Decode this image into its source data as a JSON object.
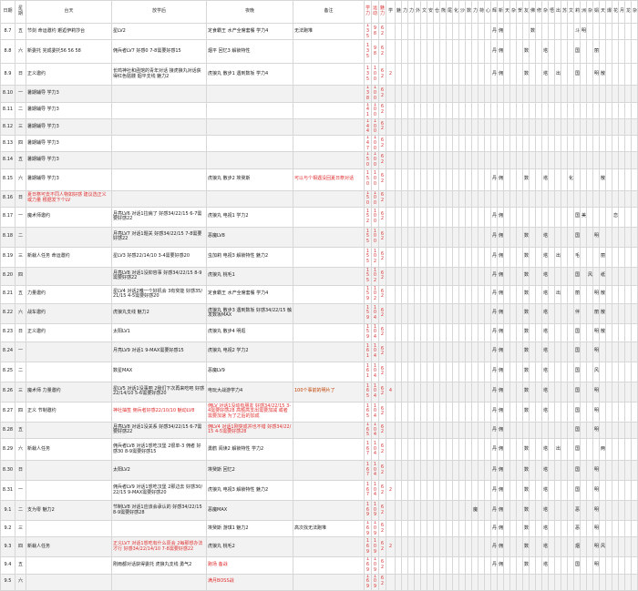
{
  "headers": [
    "日期",
    "星期",
    "台天",
    "放学后",
    "夜晚",
    "备注",
    "学力",
    "运动",
    "魅力",
    "学",
    "魅",
    "力",
    "力",
    "外",
    "文",
    "安",
    "仓",
    "熊",
    "尾",
    "化",
    "沙",
    "数",
    "力",
    "荷",
    "心",
    "辉",
    "新",
    "天",
    "杂",
    "贺",
    "友",
    "佛",
    "修",
    "杂",
    "悟",
    "出",
    "苏",
    "文",
    "莉",
    "洲",
    "杂",
    "娟",
    "天",
    "爆",
    "花",
    "月",
    "龙",
    "杂",
    "事"
  ],
  "rows": [
    {
      "h": 15,
      "d": "8.7",
      "w": "五",
      "t": "节剑 命运邀约 邂逅伊莉莎台",
      "a": "星LV2",
      "n": "定食霸王 水产全席套餐 学力4",
      "r": "无法跑堆",
      "s1": "135",
      "s2": "98",
      "s3": "62",
      "e": {
        "25": "丹",
        "26": "佣",
        "31": "数",
        "38": "斗",
        "39": "明"
      }
    },
    {
      "h": 26,
      "d": "8.8",
      "w": "六",
      "t": "新委托 完成委托56 56 58",
      "a": "佣兵者LV7 好感0 7-8需要好感15",
      "n": "烟平 回忆3 解锁特性",
      "s1": "135",
      "s2": "98",
      "s3": "62",
      "e": {
        "25": "丹",
        "26": "佣",
        "30": "数",
        "33": "塔",
        "38": "国",
        "41": "丽"
      }
    },
    {
      "h": 24,
      "d": "8.9",
      "w": "日",
      "t": "正义邀约",
      "a": "长鸣神社和函馆的青年对话 接虎狼丸对话获得红色骷髅 烟平支线 魅力2",
      "n": "虎狼丸 散步1 遇到数坂 学力4",
      "s1": "135",
      "s2": "100",
      "s3": "62",
      "s4": "2",
      "e": {
        "25": "丹",
        "26": "佣",
        "30": "数",
        "33": "塔",
        "35": "出",
        "38": "国",
        "41": "明",
        "42": "散"
      }
    },
    {
      "h": 7,
      "z": true,
      "d": "8.10",
      "w": "一",
      "t": "暑期辅导 学力3",
      "s1": "138",
      "s2": "100",
      "s3": "62"
    },
    {
      "h": 7,
      "d": "8.11",
      "w": "二",
      "t": "暑期辅导 学力3",
      "s1": "141",
      "s2": "100",
      "s3": "62"
    },
    {
      "h": 7,
      "z": true,
      "d": "8.12",
      "w": "三",
      "t": "暑期辅导 学力3",
      "s1": "144",
      "s2": "100",
      "s3": "62"
    },
    {
      "h": 7,
      "d": "8.13",
      "w": "四",
      "t": "暑期辅导 学力3",
      "s1": "147",
      "s2": "100",
      "s3": "62"
    },
    {
      "h": 7,
      "z": true,
      "d": "8.14",
      "w": "五",
      "t": "暑期辅导 学力3",
      "s1": "150",
      "s2": "100",
      "s3": "62"
    },
    {
      "h": 24,
      "d": "8.15",
      "w": "六",
      "t": "暑期辅导 学力3",
      "n": "虎狼丸 散步2 埃癸斯",
      "r": "可以与个相遇没回夏日祭对话",
      "rr": true,
      "s1": "150",
      "s2": "100",
      "s3": "62",
      "e": {
        "25": "丹",
        "26": "佣",
        "30": "数",
        "33": "塔",
        "37": "化",
        "42": "散"
      }
    },
    {
      "h": 16,
      "z": true,
      "d": "8.16",
      "w": "日",
      "t": "夏日祭可去不同人物如好感 建议选正义或力量 根据发下个LV",
      "tr": true,
      "s1": "150",
      "s2": "100",
      "s3": "62"
    },
    {
      "h": 22,
      "d": "8.17",
      "w": "一",
      "t": "魔术师邀约",
      "a": "月亮LV6 对话1拉病了 好感34/22/15 6-7需要好感22",
      "n": "虎狼丸 电视1 学力2",
      "s1": "152",
      "s2": "100",
      "s3": "62",
      "e": {
        "25": "丹",
        "26": "佣",
        "38": "国",
        "39": "美",
        "44": "恋"
      }
    },
    {
      "h": 22,
      "z": true,
      "d": "8.18",
      "w": "二",
      "a": "月亮LV7 对话1题关 好感34/22/15 7-8需要好感22",
      "n": "恶魔LV8",
      "s1": "155",
      "s2": "100",
      "s3": "62",
      "e": {
        "25": "丹",
        "26": "佣",
        "30": "数",
        "33": "塔",
        "38": "国",
        "41": "明"
      }
    },
    {
      "h": 22,
      "d": "8.19",
      "w": "三",
      "t": "新栽人任务 命运邀约",
      "a": "星LV3 好感22/14/10 3-4需要好感20",
      "n": "虫加莉 电视3 解锁特性 魅力2",
      "s1": "155",
      "s2": "102",
      "s3": "62",
      "e": {
        "25": "丹",
        "26": "佣",
        "30": "数",
        "33": "塔",
        "35": "出",
        "38": "毛",
        "42": "丽"
      }
    },
    {
      "h": 20,
      "z": true,
      "d": "8.20",
      "w": "四",
      "a": "月亮LV8 对话1没抑容事 好感34/22/15 8-9需要好感22",
      "n": "虎狼丸 桃毛1",
      "s1": "155",
      "s2": "102",
      "s3": "62",
      "e": {
        "25": "丹",
        "26": "佣",
        "30": "数",
        "33": "塔",
        "38": "国",
        "40": "风",
        "42": "纸"
      }
    },
    {
      "h": 20,
      "d": "8.21",
      "w": "五",
      "t": "力量邀约",
      "a": "星LV4 对话2唯一个好机会 3有突能 好感35/21/15 4-5需要好感20",
      "n": "定食霸王 水产全席套餐 学力4",
      "s1": "159",
      "s2": "102",
      "s3": "62",
      "e": {
        "25": "丹",
        "26": "佣",
        "30": "数",
        "33": "塔",
        "35": "出",
        "38": "丽",
        "41": "明",
        "42": "散"
      }
    },
    {
      "h": 22,
      "z": true,
      "d": "8.22",
      "w": "六",
      "t": "战车邀约",
      "a": "虎狼丸支线 魅力2",
      "n": "虎狼丸 散步3 遇到数坂 好感34/22/15 触发数坂MAX",
      "s1": "159",
      "s2": "104",
      "s3": "62",
      "e": {
        "25": "丹",
        "26": "佣",
        "30": "数",
        "33": "塔",
        "38": "伴",
        "41": "丽",
        "42": "散"
      }
    },
    {
      "h": 20,
      "d": "8.23",
      "w": "日",
      "t": "正义邀约",
      "a": "太阳LV1",
      "n": "虎狼丸 散步4 明逛",
      "s1": "159",
      "s2": "104",
      "s3": "62",
      "e": {
        "25": "丹",
        "26": "佣",
        "30": "数",
        "33": "塔",
        "38": "国",
        "41": "明",
        "42": "散"
      }
    },
    {
      "h": 22,
      "z": true,
      "d": "8.24",
      "w": "一",
      "a": "月亮LV9 对话1 9-MAX需要好感15",
      "n": "虎狼丸 电视2 学力2",
      "s1": "161",
      "s2": "104",
      "s3": "62",
      "e": {
        "25": "丹",
        "26": "佣",
        "30": "数",
        "33": "塔",
        "38": "国",
        "41": "明"
      }
    },
    {
      "h": 22,
      "d": "8.25",
      "w": "二",
      "a": "数星MAX",
      "n": "恶魔LV9",
      "s1": "161",
      "s2": "104",
      "s3": "62",
      "e": {
        "25": "丹",
        "26": "佣",
        "30": "数",
        "33": "塔",
        "38": "国",
        "41": "风"
      }
    },
    {
      "h": 22,
      "z": true,
      "d": "8.26",
      "w": "三",
      "t": "魔术师 力量邀约",
      "a": "星LV5 对话1没事吧 2我们下次再来吃吧 好感22/14/10 5-6需要好感20",
      "n": "电玩大战游学力4",
      "r": "100个事前的明片了",
      "hl": true,
      "s1": "165",
      "s2": "104",
      "s3": "62",
      "s4": "4",
      "e": {
        "25": "丹",
        "26": "佣",
        "30": "数",
        "33": "塔",
        "38": "国",
        "41": "明"
      }
    },
    {
      "h": 22,
      "d": "8.27",
      "w": "四",
      "t": "正义 节制邀约",
      "a": "神社抽签 佣兵者好感22/10/10 魅动LV8",
      "ar": true,
      "n": "佣LV 对话1没动有朋友 好感34/22/15 3-4需要好感28 高额高支出需要加减 或者需要加速 为了之后的加成",
      "nr": true,
      "s1": "165",
      "s2": "104",
      "s3": "62",
      "e": {
        "25": "丹",
        "26": "佣",
        "30": "数",
        "33": "塔",
        "38": "国",
        "41": "明"
      }
    },
    {
      "h": 14,
      "z": true,
      "d": "8.28",
      "w": "五",
      "a": "月亮LV8 对话1没关系 好感34/22/15 6-7需要好感22",
      "n": "佣LV4 对话1刚突成并也不错 好感34/22/15 4-5需要好感28",
      "nr": true,
      "s1": "165",
      "s2": "104",
      "s3": "62",
      "e": {
        "25": "丹",
        "26": "佣",
        "38": "国",
        "41": "明"
      }
    },
    {
      "h": 24,
      "d": "8.29",
      "w": "六",
      "t": "新栽人任务",
      "a": "佣兵者LV8 对话1想吃汉堡 2很单-3 佣者 好感30 8-9需要好感15",
      "n": "勇鹤 阅读2 解锁特性 学力2",
      "s1": "167",
      "s2": "104",
      "s3": "62",
      "e": {
        "25": "丹",
        "26": "佣",
        "30": "数",
        "33": "塔",
        "35": "出",
        "38": "国",
        "42": "两"
      }
    },
    {
      "h": 22,
      "z": true,
      "d": "8.30",
      "w": "日",
      "a": "太阳LV2",
      "n": "埃癸斯 回忆2",
      "s1": "167",
      "s2": "104",
      "s3": "62",
      "e": {
        "25": "丹",
        "26": "佣",
        "30": "数",
        "33": "塔",
        "38": "国",
        "41": "明"
      }
    },
    {
      "h": 22,
      "d": "8.31",
      "w": "一",
      "a": "佣兵者LV9 对话1想吃汉堡 2那边去 好感30/22/15 9-MAX需要好感20",
      "n": "虎狼丸 电视3 解锁特性 魅力2",
      "s1": "167",
      "s2": "104",
      "s3": "62",
      "s4": "2",
      "e": {
        "25": "丹",
        "26": "佣",
        "30": "数",
        "33": "塔",
        "38": "国",
        "41": "明"
      }
    },
    {
      "h": 22,
      "z": true,
      "d": "9.1",
      "w": "二",
      "t": "支为零 魅力2",
      "a": "节制LV8 对话1应该会承认的 好感34/22/15 8-9需要好感28",
      "n": "恶魔MAX",
      "s1": "169",
      "s2": "109",
      "s3": "62",
      "e": {
        "22": "魔",
        "25": "丹",
        "26": "佣",
        "30": "数",
        "33": "塔",
        "38": "恶",
        "41": "明"
      }
    },
    {
      "h": 14,
      "d": "9.2",
      "w": "三",
      "n": "埃癸斯 游琪1 魅力2",
      "r": "高次找无法跑堆",
      "s1": "169",
      "s2": "109",
      "s3": "62",
      "e": {
        "25": "丹",
        "26": "佣",
        "30": "数",
        "33": "塔",
        "38": "恶",
        "41": "明"
      }
    },
    {
      "h": 22,
      "z": true,
      "d": "9.3",
      "w": "四",
      "t": "新栽人任务",
      "a": "正义LV7 对话1想吃有什么原会 2每那想办法才行 好感34/22/14/10 7-8需要好感22",
      "ar": true,
      "n": "虎狼丸 桃毛2",
      "s1": "169",
      "s2": "109",
      "s3": "62",
      "s4": "2",
      "e": {
        "25": "丹",
        "26": "佣",
        "30": "数",
        "33": "塔",
        "38": "烟",
        "41": "明",
        "42": "风"
      }
    },
    {
      "h": 14,
      "d": "9.4",
      "w": "五",
      "a": "刚雨都对话获得委托 虎狼丸支线 勇气2",
      "n": "跑场 备战",
      "nr": true,
      "s1": "169",
      "s2": "109",
      "s3": "62",
      "e": {
        "25": "丹",
        "26": "佣",
        "30": "数",
        "33": "塔",
        "38": "国",
        "41": "明"
      }
    },
    {
      "h": 10,
      "z": true,
      "d": "9.5",
      "w": "六",
      "n": "满月BOSS战",
      "nr": true,
      "s1": "169",
      "s2": "109",
      "s3": "62"
    }
  ],
  "colors": {
    "stat": "#d63a3a",
    "highlight": "#ffea00",
    "zebra": "#f2f2f2",
    "grid": "#d7d7d7"
  }
}
